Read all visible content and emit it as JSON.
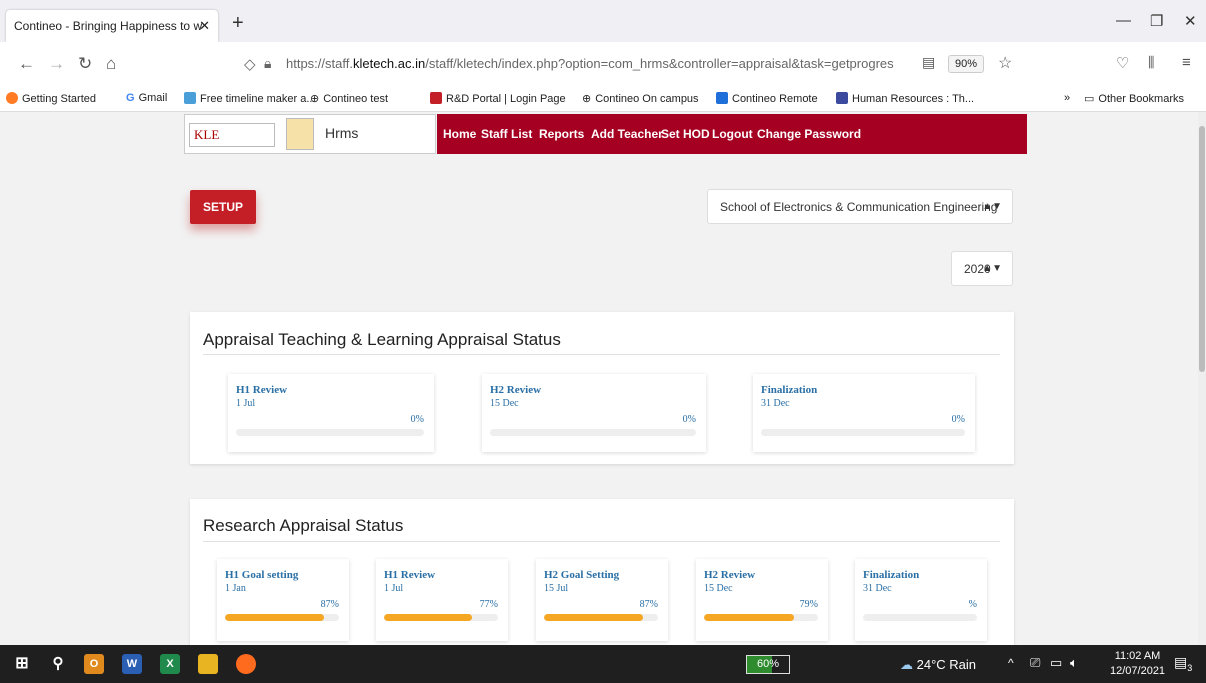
{
  "browser": {
    "tab_title": "Contineo - Bringing Happiness to w",
    "url_prefix": "https://staff.",
    "url_domain": "kletech.ac.in",
    "url_rest": "/staff/kletech/index.php?option=com_hrms&controller=appraisal&task=getprogres",
    "zoom": "90%",
    "bookmarks": [
      "Getting Started",
      "Gmail",
      "Free timeline maker a...",
      "Contineo test",
      "R&D Portal | Login Page",
      "Contineo On campus",
      "Contineo Remote",
      "Human Resources : Th...",
      "Other Bookmarks"
    ]
  },
  "header": {
    "logo_text": "KLE",
    "app_name": "Hrms",
    "menu": [
      "Home",
      "Staff List",
      "Reports",
      "Add Teacher",
      "Set HOD",
      "Logout",
      "Change Password"
    ]
  },
  "controls": {
    "setup_label": "SETUP",
    "school": "School of Electronics & Communication Engineering",
    "year": "2020"
  },
  "teaching": {
    "title": "Appraisal Teaching & Learning Appraisal Status",
    "tiles": [
      {
        "title": "H1 Review",
        "date": "1 Jul",
        "percent_label": "0%",
        "progress": 0
      },
      {
        "title": "H2 Review",
        "date": "15 Dec",
        "percent_label": "0%",
        "progress": 0
      },
      {
        "title": "Finalization",
        "date": "31 Dec",
        "percent_label": "0%",
        "progress": 0
      }
    ]
  },
  "research": {
    "title": "Research Appraisal Status",
    "tiles": [
      {
        "title": "H1 Goal setting",
        "date": "1 Jan",
        "percent_label": "87%",
        "progress": 87
      },
      {
        "title": "H1 Review",
        "date": "1 Jul",
        "percent_label": "77%",
        "progress": 77
      },
      {
        "title": "H2 Goal Setting",
        "date": "15 Jul",
        "percent_label": "87%",
        "progress": 87
      },
      {
        "title": "H2 Review",
        "date": "15 Dec",
        "percent_label": "79%",
        "progress": 79
      },
      {
        "title": "Finalization",
        "date": "31 Dec",
        "percent_label": "%",
        "progress": 0
      }
    ]
  },
  "taskbar": {
    "battery": "60%",
    "weather": "24°C Rain",
    "time": "11:02 AM",
    "date": "12/07/2021",
    "notification_count": "3"
  },
  "colors": {
    "accent": "#a50022",
    "setup": "#c41e26",
    "progress": "#f5a623",
    "tile_text": "#2a6fa5"
  }
}
